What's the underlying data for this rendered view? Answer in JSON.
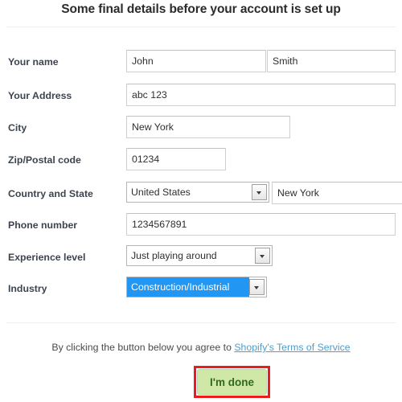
{
  "page": {
    "title": "Some final details before your account is set up"
  },
  "form": {
    "rows": [
      {
        "label": "Your name",
        "fields": [
          {
            "kind": "text",
            "name": "first-name-input",
            "value": "John"
          },
          {
            "kind": "text",
            "name": "last-name-input",
            "value": "Smith"
          }
        ]
      },
      {
        "label": "Your Address",
        "fields": [
          {
            "kind": "text",
            "name": "address-input",
            "value": "abc 123"
          }
        ]
      },
      {
        "label": "City",
        "fields": [
          {
            "kind": "text",
            "name": "city-input",
            "value": "New York"
          }
        ]
      },
      {
        "label": "Zip/Postal code",
        "fields": [
          {
            "kind": "text",
            "name": "zip-input",
            "value": "01234"
          }
        ]
      },
      {
        "label": "Country and State",
        "fields": [
          {
            "kind": "select",
            "name": "country-select",
            "value": "United States"
          },
          {
            "kind": "text",
            "name": "state-input",
            "value": "New York"
          }
        ]
      },
      {
        "label": "Phone number",
        "fields": [
          {
            "kind": "text",
            "name": "phone-input",
            "value": "1234567891"
          }
        ]
      },
      {
        "label": "Experience level",
        "fields": [
          {
            "kind": "select",
            "name": "experience-select",
            "value": "Just playing around"
          }
        ]
      },
      {
        "label": "Industry",
        "fields": [
          {
            "kind": "select",
            "name": "industry-select",
            "value": "Construction/Industrial",
            "focused": true
          }
        ]
      }
    ]
  },
  "footer": {
    "agree_prefix": "By clicking the button below you agree to ",
    "terms_link": "Shopify's Terms of Service",
    "done_label": "I'm done"
  },
  "colors": {
    "selection_blue": "#2196f3",
    "button_green_bg": "#cfe8a8",
    "button_green_text": "#2e6b1f",
    "annotation_red": "#ec1c1c",
    "link_blue": "#4d9ec9"
  }
}
